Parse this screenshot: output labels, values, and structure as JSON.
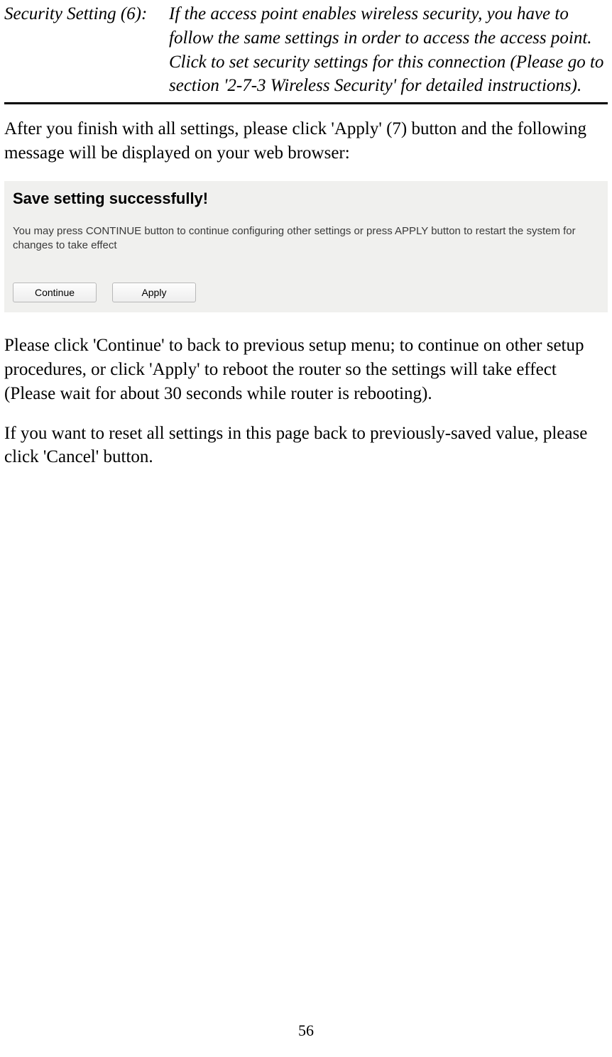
{
  "definition": {
    "term": "Security Setting (6):",
    "body": "If the access point enables wireless security, you have to follow the same settings in order to access the access point. Click to set security settings for this connection   (Please go to section '2-7-3 Wireless Security' for detailed instructions)."
  },
  "para1": "After you finish with all settings, please click 'Apply' (7) button and the following message will be displayed on your web browser:",
  "dialog": {
    "title": "Save setting successfully!",
    "message": "You may press CONTINUE button to continue configuring other settings or press APPLY button to restart the system for changes to take effect",
    "btn_continue": "Continue",
    "btn_apply": "Apply"
  },
  "para2": "Please click 'Continue' to back to previous setup menu; to continue on other setup procedures, or click 'Apply' to reboot the router so the settings will take effect (Please wait for about 30 seconds while router is rebooting).",
  "para3": "If you want to reset all settings in this page back to previously-saved value, please click 'Cancel' button.",
  "page_number": "56"
}
